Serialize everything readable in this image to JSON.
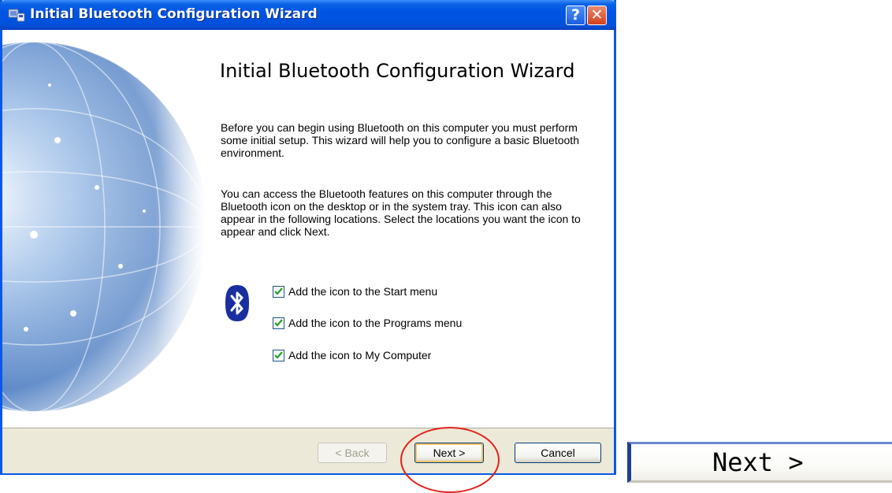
{
  "window": {
    "title": "Initial Bluetooth Configuration Wizard",
    "help_label": "?",
    "close_label": "✕"
  },
  "content": {
    "heading": "Initial Bluetooth Configuration Wizard",
    "paragraph1": "Before you can begin using Bluetooth on this computer you must perform some initial setup. This wizard will help you to configure a basic Bluetooth environment.",
    "paragraph2": "You can access the Bluetooth features on this computer through the Bluetooth icon on the desktop or in the system tray. This icon can also appear in the following locations. Select the locations you want the icon to appear and click Next.",
    "options": [
      {
        "label": "Add the icon to the Start menu",
        "checked": true
      },
      {
        "label": "Add the icon to the Programs menu",
        "checked": true
      },
      {
        "label": "Add the icon to My Computer",
        "checked": true
      }
    ]
  },
  "buttons": {
    "back": "< Back",
    "next": "Next >",
    "cancel": "Cancel"
  },
  "zoom_callout": {
    "label": "Next >"
  },
  "colors": {
    "titlebar": "#0054e3",
    "frame": "#0a58e8",
    "dialog_bg": "#ece9d8",
    "highlight_ring": "#e1231e",
    "bluetooth_icon": "#1a2f9e",
    "checkmark": "#21a121"
  }
}
